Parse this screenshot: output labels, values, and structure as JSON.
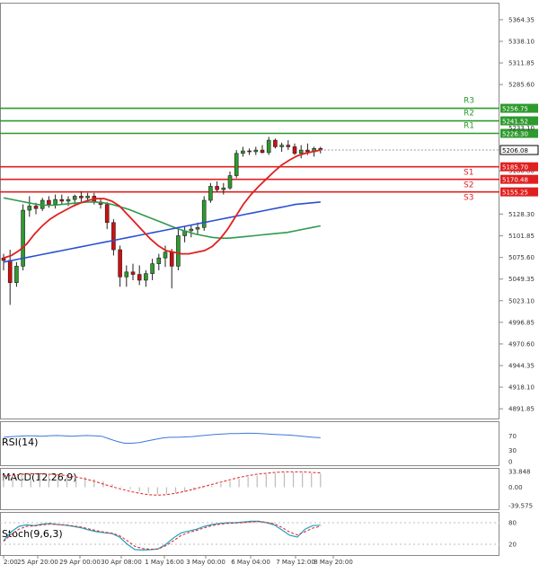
{
  "chart_data": {
    "type": "candlestick",
    "main": {
      "y_ticks": [
        "5364.35",
        "5338.10",
        "5311.85",
        "5285.60",
        "5180.80",
        "5128.30",
        "5101.85",
        "5075.60",
        "5049.35",
        "5023.10",
        "4996.85",
        "4970.60",
        "4944.35",
        "4918.10",
        "4891.85"
      ],
      "ylim": [
        4880,
        5385
      ],
      "last_price": "5206.08",
      "last_price_value": 5206.08,
      "levels": [
        {
          "name": "R3",
          "value": 5256.75,
          "value_label": "5256.75",
          "color": "#2e9a2e"
        },
        {
          "name": "R2",
          "value": 5241.52,
          "value_label": "5241.52",
          "color": "#2e9a2e"
        },
        {
          "name": "R1",
          "value": 5226.3,
          "value_label": "5226.30",
          "color": "#2e9a2e"
        },
        {
          "name": "S1",
          "value": 5185.7,
          "value_label": "5185.70",
          "color": "#e02020"
        },
        {
          "name": "S2",
          "value": 5170.48,
          "value_label": "5170.48",
          "color": "#e02020"
        },
        {
          "name": "S3",
          "value": 5155.25,
          "value_label": "5155.25",
          "color": "#e02020"
        }
      ],
      "extra_label": "5233.10",
      "candles": [
        [
          5075,
          5080,
          5060,
          5072
        ],
        [
          5072,
          5085,
          5018,
          5045
        ],
        [
          5045,
          5070,
          5040,
          5065
        ],
        [
          5065,
          5140,
          5060,
          5133
        ],
        [
          5133,
          5150,
          5125,
          5138
        ],
        [
          5138,
          5142,
          5128,
          5135
        ],
        [
          5135,
          5148,
          5132,
          5145
        ],
        [
          5145,
          5150,
          5136,
          5140
        ],
        [
          5140,
          5152,
          5135,
          5146
        ],
        [
          5146,
          5152,
          5140,
          5144
        ],
        [
          5144,
          5150,
          5138,
          5146
        ],
        [
          5146,
          5152,
          5140,
          5150
        ],
        [
          5150,
          5156,
          5142,
          5148
        ],
        [
          5148,
          5154,
          5144,
          5150
        ],
        [
          5150,
          5154,
          5140,
          5143
        ],
        [
          5143,
          5148,
          5135,
          5140
        ],
        [
          5140,
          5143,
          5110,
          5118
        ],
        [
          5118,
          5122,
          5078,
          5085
        ],
        [
          5085,
          5090,
          5040,
          5052
        ],
        [
          5052,
          5066,
          5040,
          5058
        ],
        [
          5058,
          5068,
          5048,
          5055
        ],
        [
          5055,
          5066,
          5042,
          5048
        ],
        [
          5048,
          5060,
          5040,
          5056
        ],
        [
          5056,
          5074,
          5048,
          5068
        ],
        [
          5068,
          5080,
          5060,
          5075
        ],
        [
          5075,
          5090,
          5064,
          5082
        ],
        [
          5082,
          5086,
          5038,
          5065
        ],
        [
          5065,
          5110,
          5060,
          5102
        ],
        [
          5102,
          5114,
          5094,
          5108
        ],
        [
          5108,
          5115,
          5100,
          5110
        ],
        [
          5110,
          5118,
          5104,
          5112
        ],
        [
          5112,
          5150,
          5108,
          5145
        ],
        [
          5145,
          5166,
          5142,
          5162
        ],
        [
          5162,
          5168,
          5155,
          5158
        ],
        [
          5158,
          5166,
          5152,
          5160
        ],
        [
          5160,
          5180,
          5158,
          5175
        ],
        [
          5175,
          5206,
          5172,
          5202
        ],
        [
          5202,
          5210,
          5198,
          5205
        ],
        [
          5205,
          5208,
          5200,
          5204
        ],
        [
          5204,
          5210,
          5200,
          5206
        ],
        [
          5206,
          5212,
          5202,
          5203
        ],
        [
          5203,
          5222,
          5200,
          5218
        ],
        [
          5218,
          5220,
          5208,
          5210
        ],
        [
          5210,
          5215,
          5204,
          5212
        ],
        [
          5212,
          5218,
          5206,
          5210
        ],
        [
          5210,
          5214,
          5200,
          5202
        ],
        [
          5202,
          5212,
          5196,
          5206
        ],
        [
          5206,
          5214,
          5200,
          5204
        ],
        [
          5204,
          5210,
          5198,
          5208
        ],
        [
          5208,
          5210,
          5202,
          5206
        ]
      ],
      "ma_red": [
        5075,
        5078,
        5084,
        5092,
        5104,
        5114,
        5122,
        5128,
        5133,
        5138,
        5142,
        5145,
        5147,
        5147,
        5144,
        5138,
        5128,
        5118,
        5108,
        5098,
        5090,
        5084,
        5082,
        5080,
        5080,
        5082,
        5084,
        5089,
        5098,
        5110,
        5125,
        5140,
        5152,
        5162,
        5171,
        5180,
        5188,
        5194,
        5199,
        5202,
        5204,
        5206
      ],
      "ma_blue": [
        5070,
        5072,
        5074,
        5076,
        5078,
        5080,
        5082,
        5084,
        5086,
        5088,
        5090,
        5092,
        5094,
        5096,
        5098,
        5100,
        5102,
        5104,
        5106,
        5108,
        5110,
        5112,
        5114,
        5116,
        5118,
        5120,
        5122,
        5124,
        5126,
        5128,
        5130,
        5132,
        5134,
        5136,
        5138,
        5140,
        5141,
        5142,
        5143
      ],
      "ma_green": [
        5148,
        5146,
        5144,
        5142,
        5140,
        5139,
        5139,
        5140,
        5141,
        5142,
        5143,
        5143,
        5142,
        5140,
        5137,
        5134,
        5130,
        5126,
        5122,
        5118,
        5114,
        5110,
        5107,
        5104,
        5102,
        5100,
        5099,
        5099,
        5100,
        5101,
        5102,
        5103,
        5104,
        5105,
        5106,
        5108,
        5110,
        5112,
        5114
      ]
    },
    "x_ticks": [
      "2:00",
      "25 Apr 20:00",
      "29 Apr 00:00",
      "30 Apr 08:00",
      "1 May 16:00",
      "3 May 00:00",
      "6 May 04:00",
      "7 May 12:00",
      "8 May 20:00"
    ],
    "rsi": {
      "label": "RSI(14)",
      "ticks": [
        "70",
        "30",
        "0"
      ],
      "values": [
        66,
        68,
        69,
        70,
        70,
        69,
        70,
        71,
        70,
        69,
        70,
        71,
        70,
        69,
        62,
        55,
        50,
        50,
        52,
        56,
        60,
        64,
        66,
        66,
        67,
        68,
        70,
        72,
        74,
        75,
        76,
        76,
        77,
        77,
        76,
        75,
        74,
        73,
        72,
        70,
        68,
        66,
        65
      ]
    },
    "macd": {
      "label": "MACD(12,26,9)",
      "ticks": [
        "33.848",
        "0.00",
        "-39.575"
      ],
      "histogram": [
        27,
        28,
        30,
        31,
        30,
        29,
        28,
        27,
        25,
        22,
        18,
        13,
        7,
        2,
        -4,
        -9,
        -13,
        -15,
        -15,
        -13,
        -10,
        -6,
        -2,
        3,
        8,
        13,
        18,
        22,
        25,
        28,
        30,
        31,
        32,
        31,
        30,
        29
      ],
      "signal": [
        24,
        26,
        28,
        29,
        29,
        28,
        27,
        25,
        22,
        18,
        13,
        7,
        1,
        -4,
        -9,
        -13,
        -16,
        -17,
        -16,
        -13,
        -9,
        -4,
        1,
        6,
        11,
        16,
        21,
        25,
        28,
        30,
        32,
        33,
        33,
        33,
        32,
        31
      ]
    },
    "stoch": {
      "label": "Stoch(9,6,3)",
      "ticks": [
        "80",
        "20"
      ],
      "k": [
        30,
        55,
        70,
        74,
        72,
        76,
        78,
        75,
        73,
        70,
        66,
        60,
        55,
        52,
        50,
        40,
        20,
        5,
        4,
        5,
        7,
        20,
        38,
        52,
        57,
        62,
        70,
        75,
        78,
        80,
        80,
        82,
        84,
        84,
        80,
        74,
        60,
        45,
        40,
        62,
        72,
        73
      ],
      "d": [
        28,
        48,
        62,
        70,
        71,
        74,
        76,
        75,
        74,
        71,
        68,
        63,
        58,
        54,
        51,
        44,
        30,
        14,
        8,
        6,
        7,
        16,
        30,
        45,
        53,
        59,
        66,
        72,
        76,
        78,
        79,
        80,
        82,
        83,
        81,
        77,
        67,
        54,
        46,
        55,
        65,
        70
      ]
    },
    "colors": {
      "bull": "#2e9a2e",
      "bear": "#cc1010",
      "ma_red": "#e02020",
      "ma_blue": "#2a4fd4",
      "ma_green": "#2e9a4e",
      "rsi": "#3a78d8",
      "stoch_k": "#20a0c0",
      "stoch_d": "#e02020",
      "macd_hist": "#bbbbbb",
      "macd_signal": "#e02020",
      "last_price_box": "#000000"
    }
  }
}
